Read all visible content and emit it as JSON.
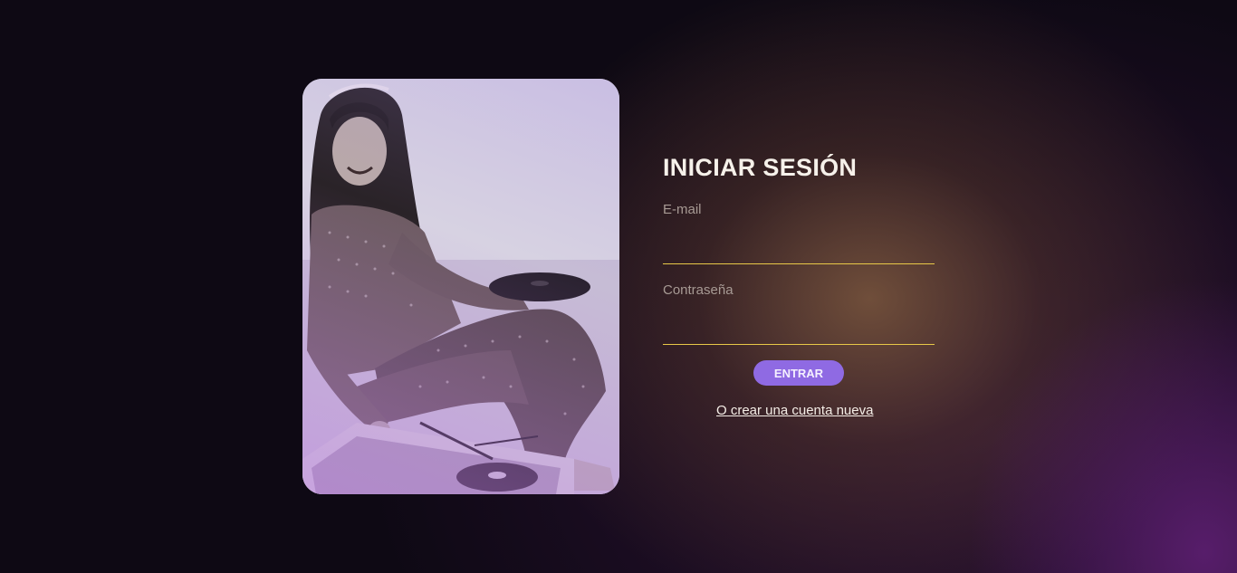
{
  "login": {
    "title": "INICIAR SESIÓN",
    "email_label": "E-mail",
    "email_value": "",
    "password_label": "Contraseña",
    "password_value": "",
    "submit_label": "ENTRAR",
    "register_link": "O crear una cuenta nueva"
  },
  "colors": {
    "accent_button": "#8f6ae3",
    "input_underline": "#e8c848",
    "page_background": "#0e0914"
  },
  "photo": {
    "icon": "vintage-photo-woman-record-player"
  }
}
